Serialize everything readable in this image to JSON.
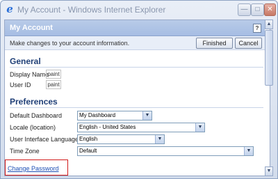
{
  "window": {
    "title": "My Account - Windows Internet Explorer",
    "icon": "ie-icon",
    "controls": {
      "minimize": "—",
      "maximize": "□",
      "close": "✕"
    }
  },
  "dialog": {
    "title": "My Account",
    "help": "?",
    "instructions": "Make changes to your account information.",
    "finished_label": "Finished",
    "cancel_label": "Cancel"
  },
  "general": {
    "heading": "General",
    "display_name_label": "Display Name",
    "display_name_value": "paint",
    "user_id_label": "User ID",
    "user_id_value": "paint"
  },
  "preferences": {
    "heading": "Preferences",
    "fields": [
      {
        "label": "Default Dashboard",
        "value": "My Dashboard"
      },
      {
        "label": "Locale (location)",
        "value": "English - United States"
      },
      {
        "label": "User Interface Language",
        "value": "English"
      },
      {
        "label": "Time Zone",
        "value": "Default"
      }
    ]
  },
  "change_password_label": "Change Password",
  "scroll": {
    "up": "▲",
    "down": "▼"
  },
  "colors": {
    "header": "#a6bde3",
    "link": "#1f50b5",
    "highlight_box": "#d01818"
  }
}
